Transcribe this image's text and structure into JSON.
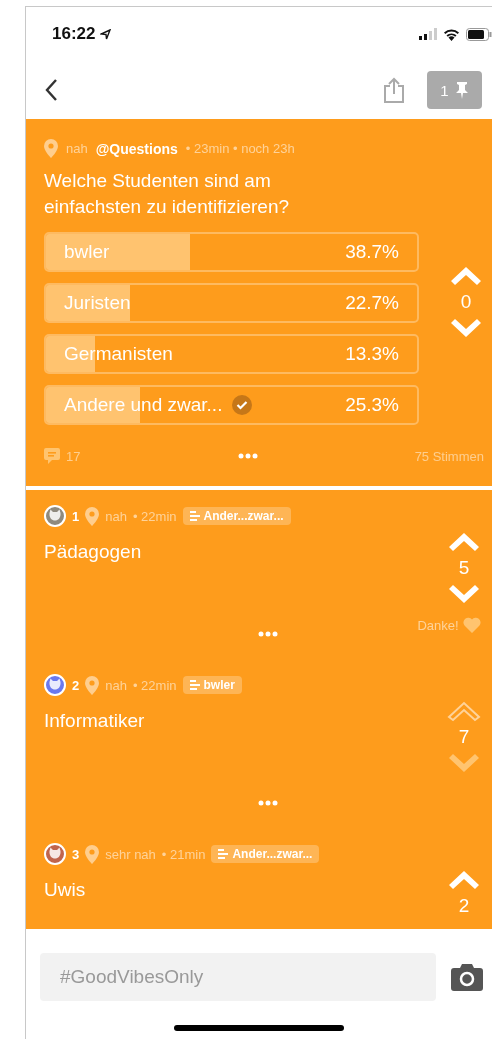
{
  "status_bar": {
    "time": "16:22"
  },
  "nav": {
    "pin_count": "1"
  },
  "poll": {
    "location": "nah",
    "channel": "@Questions",
    "meta": "• 23min • noch 23h",
    "question": "Welche Studenten sind am einfachsten zu identifizieren?",
    "options": [
      {
        "label": "bwler",
        "percent": "38.7%",
        "level": 0.387,
        "selected": false
      },
      {
        "label": "Juristen",
        "percent": "22.7%",
        "level": 0.227,
        "selected": false
      },
      {
        "label": "Germanisten",
        "percent": "13.3%",
        "level": 0.133,
        "selected": false
      },
      {
        "label": "Andere und zwar...",
        "percent": "25.3%",
        "level": 0.253,
        "selected": true
      }
    ],
    "votes": "0",
    "comments": "17",
    "total": "75 Stimmen"
  },
  "comments": [
    {
      "number": "1",
      "color": "#8f8a7e",
      "location": "nah",
      "meta": "• 22min",
      "tag": "Ander...zwar...",
      "text": "Pädagogen",
      "votes": "5",
      "vote_locked": false,
      "partial": false,
      "thanks": "Danke!"
    },
    {
      "number": "2",
      "color": "#6b78ee",
      "location": "nah",
      "meta": "• 22min",
      "tag": "bwler",
      "text": "Informatiker",
      "votes": "7",
      "vote_locked": true,
      "partial": false
    },
    {
      "number": "3",
      "color": "#c0654d",
      "location": "sehr nah",
      "meta": "• 21min",
      "tag": "Ander...zwar...",
      "text": "Uwis",
      "votes": "2",
      "vote_locked": false,
      "partial": true
    }
  ],
  "composer": {
    "placeholder": "#GoodVibesOnly"
  }
}
